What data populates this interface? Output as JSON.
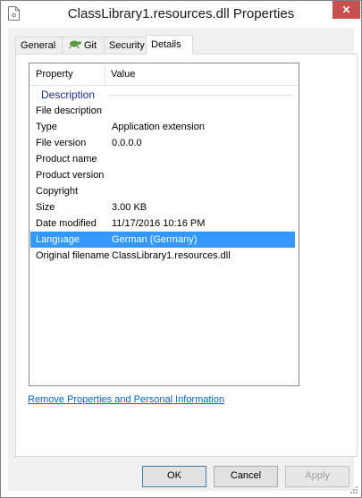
{
  "window": {
    "title": "ClassLibrary1.resources.dll Properties",
    "close_glyph": "✕"
  },
  "tabs": [
    {
      "label": "General",
      "active": false
    },
    {
      "label": "Git",
      "active": false,
      "icon": "git-turtle-icon"
    },
    {
      "label": "Security",
      "active": false
    },
    {
      "label": "Details",
      "active": true
    }
  ],
  "list": {
    "headers": {
      "property": "Property",
      "value": "Value"
    },
    "group": "Description",
    "rows": [
      {
        "property": "File description",
        "value": ""
      },
      {
        "property": "Type",
        "value": "Application extension"
      },
      {
        "property": "File version",
        "value": "0.0.0.0"
      },
      {
        "property": "Product name",
        "value": ""
      },
      {
        "property": "Product version",
        "value": ""
      },
      {
        "property": "Copyright",
        "value": ""
      },
      {
        "property": "Size",
        "value": "3.00 KB"
      },
      {
        "property": "Date modified",
        "value": "11/17/2016 10:16 PM"
      },
      {
        "property": "Language",
        "value": "German (Germany)",
        "selected": true
      },
      {
        "property": "Original filename",
        "value": "ClassLibrary1.resources.dll"
      }
    ]
  },
  "link": "Remove Properties and Personal Information",
  "buttons": {
    "ok": "OK",
    "cancel": "Cancel",
    "apply": "Apply"
  },
  "colors": {
    "accent": "#3399ff",
    "link": "#0066cc",
    "group": "#1e3287",
    "close": "#c7504f"
  }
}
